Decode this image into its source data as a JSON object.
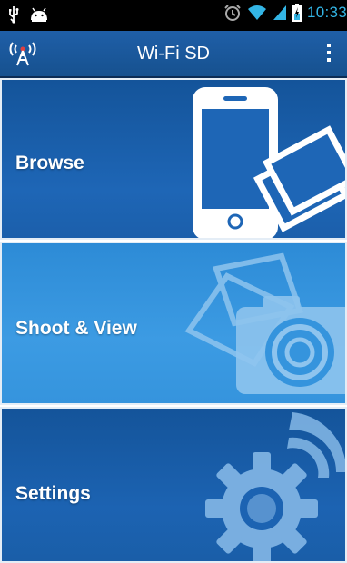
{
  "status_bar": {
    "time": "10:33",
    "icons": [
      "usb-icon",
      "android-icon",
      "alarm-icon",
      "wifi-icon",
      "signal-icon",
      "battery-icon"
    ]
  },
  "action_bar": {
    "title": "Wi-Fi SD",
    "app_icon": "wifi-tower-icon",
    "menu_icon": "overflow-menu-icon"
  },
  "tiles": [
    {
      "label": "Browse",
      "icon": "smartphone-photos-icon"
    },
    {
      "label": "Shoot & View",
      "icon": "camera-photos-icon"
    },
    {
      "label": "Settings",
      "icon": "gear-wifi-icon"
    }
  ],
  "colors": {
    "action_bar": "#1f5fa8",
    "tile_dark": "#1e66b6",
    "tile_light": "#3c9be3",
    "clock": "#33b5e5",
    "signal": "#33b5e5"
  }
}
